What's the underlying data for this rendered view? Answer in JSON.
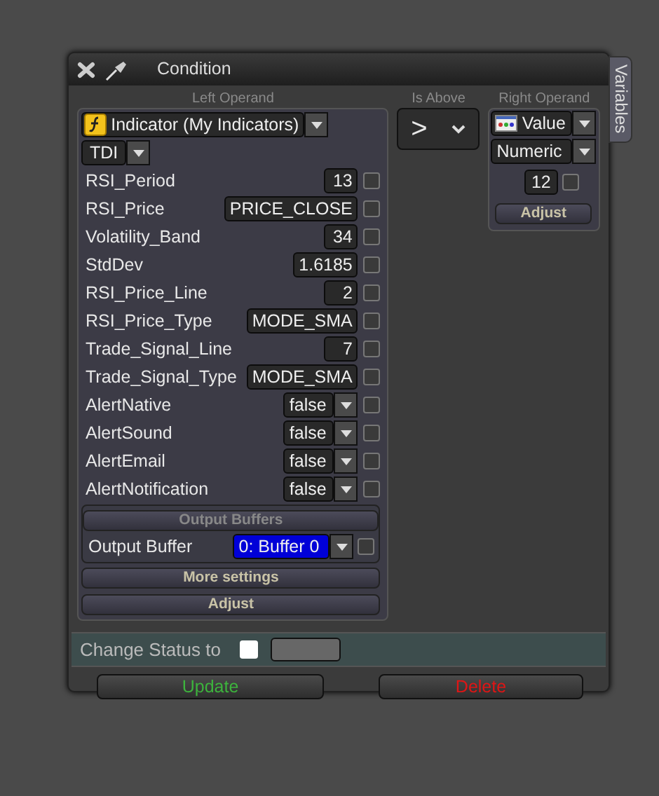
{
  "window": {
    "title": "Condition"
  },
  "variables_tab": "Variables",
  "left_operand": {
    "heading": "Left Operand",
    "source": "Indicator (My Indicators)",
    "indicator": "TDI",
    "params": [
      {
        "name": "RSI_Period",
        "value": "13",
        "kind": "input",
        "checked": false
      },
      {
        "name": "RSI_Price",
        "value": "PRICE_CLOSE",
        "kind": "input",
        "checked": false
      },
      {
        "name": "Volatility_Band",
        "value": "34",
        "kind": "input",
        "checked": false
      },
      {
        "name": "StdDev",
        "value": "1.6185",
        "kind": "input",
        "checked": false
      },
      {
        "name": "RSI_Price_Line",
        "value": "2",
        "kind": "input",
        "checked": false
      },
      {
        "name": "RSI_Price_Type",
        "value": "MODE_SMA",
        "kind": "input",
        "checked": false
      },
      {
        "name": "Trade_Signal_Line",
        "value": "7",
        "kind": "input",
        "checked": false
      },
      {
        "name": "Trade_Signal_Type",
        "value": "MODE_SMA",
        "kind": "input",
        "checked": false
      },
      {
        "name": "AlertNative",
        "value": "false",
        "kind": "dropdown",
        "checked": false
      },
      {
        "name": "AlertSound",
        "value": "false",
        "kind": "dropdown",
        "checked": false
      },
      {
        "name": "AlertEmail",
        "value": "false",
        "kind": "dropdown",
        "checked": false
      },
      {
        "name": "AlertNotification",
        "value": "false",
        "kind": "dropdown",
        "checked": false
      }
    ],
    "output_buffers": {
      "heading": "Output Buffers",
      "label": "Output Buffer",
      "value": "0: Buffer 0",
      "checked": false
    },
    "more_settings": "More settings",
    "adjust": "Adjust"
  },
  "comparator": {
    "heading": "Is Above",
    "symbol": ">"
  },
  "right_operand": {
    "heading": "Right Operand",
    "source": "Value",
    "type": "Numeric",
    "value": "12",
    "checked": false,
    "adjust": "Adjust"
  },
  "change_status": {
    "label": "Change Status to",
    "checked": false
  },
  "buttons": [
    {
      "label": "Update",
      "kind": "update"
    },
    {
      "label": "Delete",
      "kind": "delete"
    }
  ]
}
